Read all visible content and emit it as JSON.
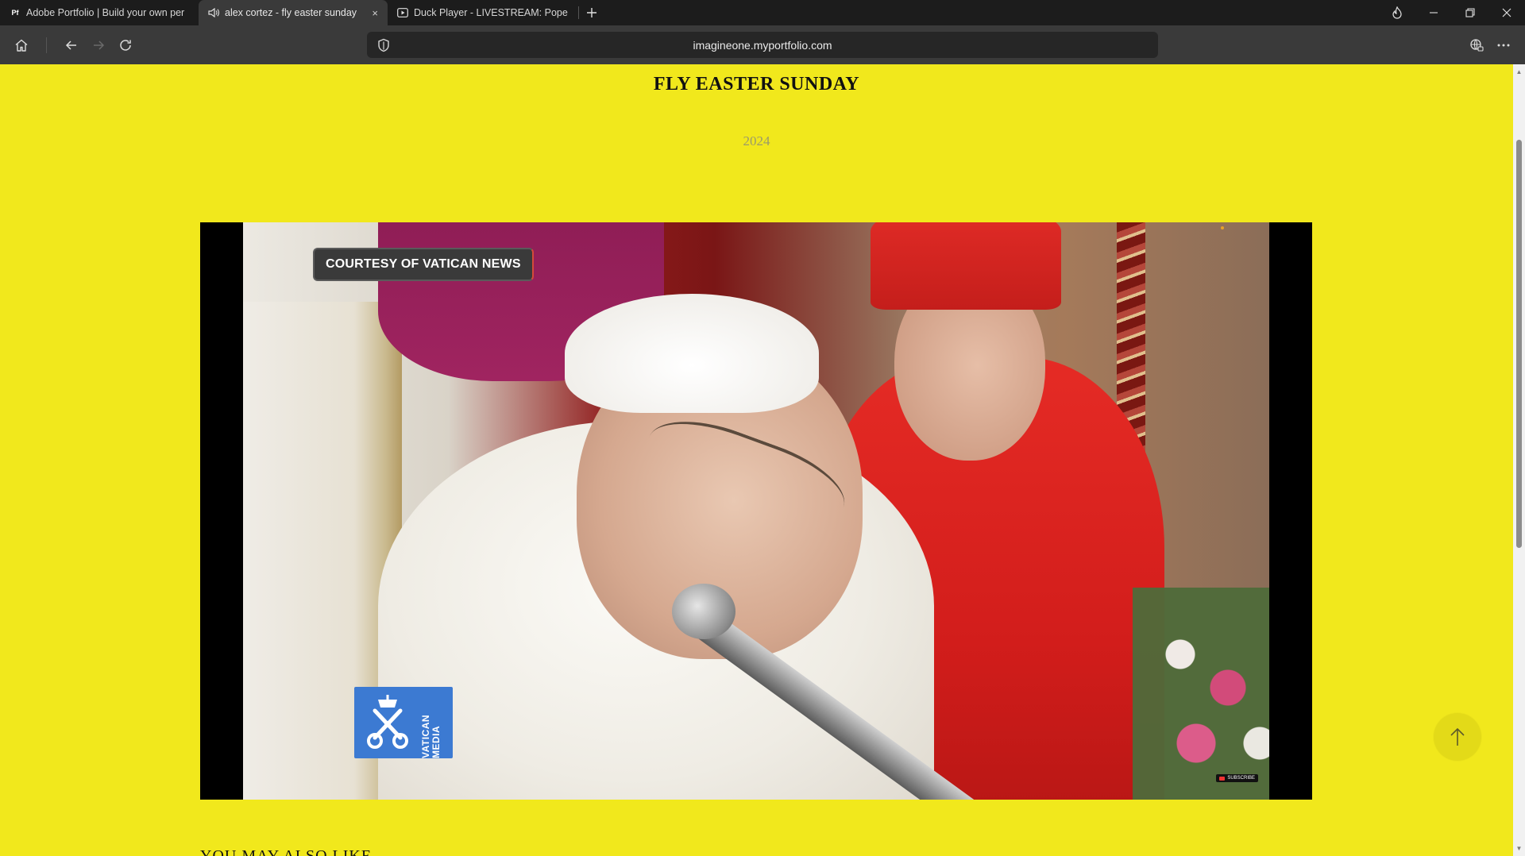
{
  "browser": {
    "tabs": [
      {
        "title": "Adobe Portfolio | Build your own per",
        "favicon": "adobe-portfolio-icon",
        "active": false
      },
      {
        "title": "alex cortez - fly easter sunday",
        "favicon": "speaker-icon",
        "active": true,
        "close": "×"
      },
      {
        "title": "Duck Player - LIVESTREAM: Pope Fran",
        "favicon": "play-icon",
        "active": false
      }
    ],
    "favicon_text": "Pf",
    "new_tab": "+",
    "url": "imagineone.myportfolio.com"
  },
  "page": {
    "title": "FLY EASTER SUNDAY",
    "year": "2024",
    "video": {
      "overlay_label": "COURTESY OF VATICAN NEWS",
      "logo_text": "VATICAN MEDIA",
      "subscribe": "SUBSCRIBE"
    },
    "also_like": "YOU MAY ALSO LIKE"
  },
  "colors": {
    "page_background": "#f1e81c",
    "browser_chrome": "#1c1c1c",
    "toolbar": "#3a3a3a",
    "vatican_blue": "#3c7ad2"
  }
}
